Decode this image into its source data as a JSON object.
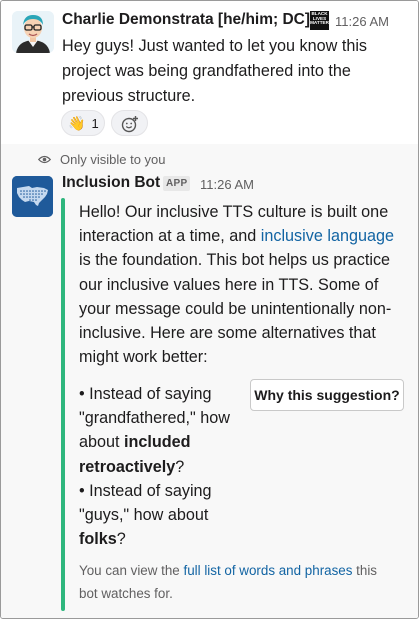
{
  "message1": {
    "author": "Charlie Demonstrata [he/him; DC]",
    "badge_text": "BLACK LIVES MATTER",
    "time": "11:26 AM",
    "text": "Hey guys! Just wanted to let you know this project was being grandfathered into the previous structure.",
    "reaction": {
      "emoji": "👋",
      "count": "1"
    }
  },
  "message2": {
    "visibility_note": "Only visible to you",
    "author": "Inclusion Bot",
    "app_badge": "APP",
    "time": "11:26 AM",
    "body_part1": "Hello! Our inclusive TTS culture is built one interaction at a time, and ",
    "body_link": "inclusive language",
    "body_part2": " is the foundation. This bot helps us practice our inclusive values here in TTS. Some of your message could be unintentionally non-inclusive. Here are some alternatives that might work better:",
    "bullet1_prefix": "• Instead of saying \"grandfathered,\" how about ",
    "bullet1_bold": "included retroactively",
    "bullet1_suffix": "?",
    "bullet2_prefix": "• Instead of saying \"guys,\" how about ",
    "bullet2_bold": "folks",
    "bullet2_suffix": "?",
    "why_button": "Why this suggestion?",
    "footer_part1": "You can view the ",
    "footer_link": "full list of words and phrases",
    "footer_part2": " this bot watches for."
  }
}
